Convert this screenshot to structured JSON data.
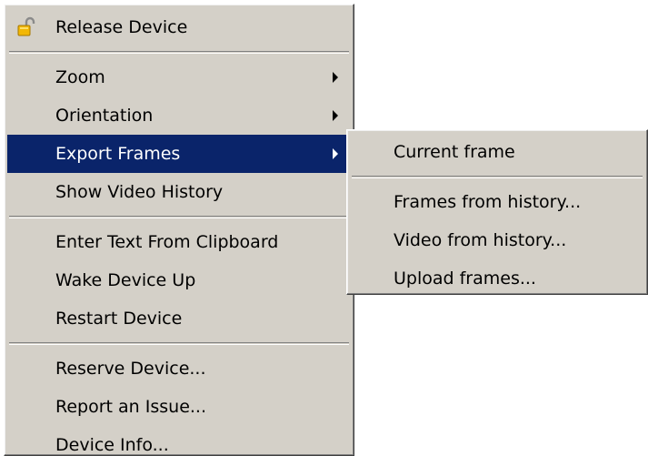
{
  "context_menu": {
    "items": [
      {
        "label": "Release Device",
        "icon": "unlock-icon"
      },
      {
        "label": "Zoom",
        "submenu": true
      },
      {
        "label": "Orientation",
        "submenu": true
      },
      {
        "label": "Export Frames",
        "submenu": true,
        "highlighted": true
      },
      {
        "label": "Show Video History"
      },
      {
        "label": "Enter Text From Clipboard"
      },
      {
        "label": "Wake Device Up"
      },
      {
        "label": "Restart Device"
      },
      {
        "label": "Reserve Device..."
      },
      {
        "label": "Report an Issue..."
      },
      {
        "label": "Device Info..."
      }
    ]
  },
  "submenu": {
    "items": [
      {
        "label": "Current frame"
      },
      {
        "label": "Frames from history..."
      },
      {
        "label": "Video from history..."
      },
      {
        "label": "Upload frames..."
      }
    ]
  },
  "colors": {
    "menu_background": "#d4d0c8",
    "highlight_background": "#0a246a",
    "highlight_text": "#ffffff",
    "text": "#000000",
    "icon_lock_body": "#f2b705"
  }
}
